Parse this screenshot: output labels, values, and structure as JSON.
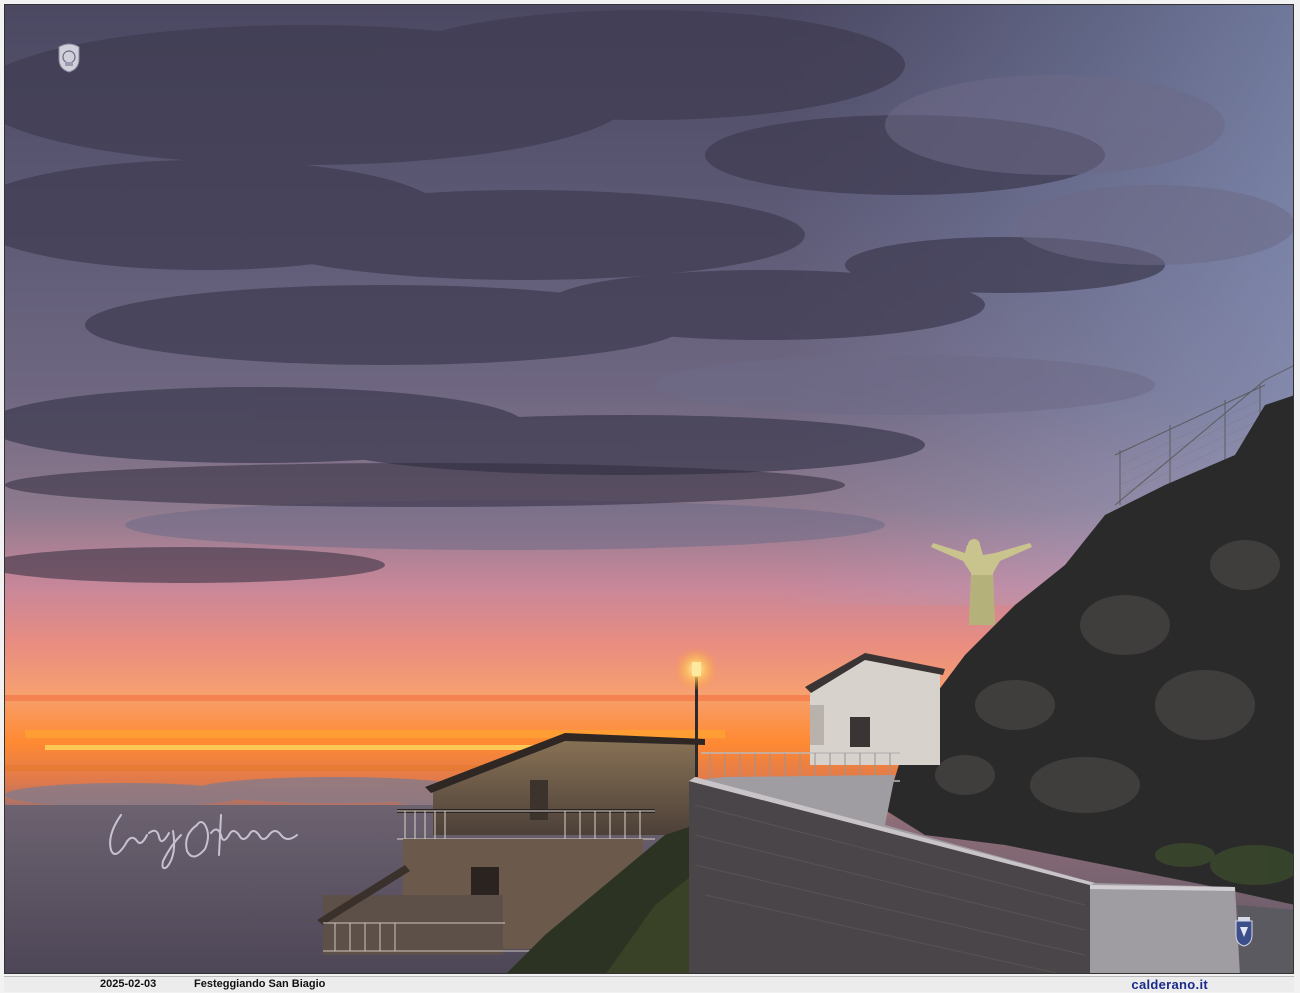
{
  "footer": {
    "date": "2025-02-03",
    "caption": "Festeggiando San Biagio",
    "site": "calderano.it"
  },
  "photo": {
    "subject": "sunset over the sea with statue of Christ on cliff",
    "colors": {
      "sky_top": "#5a5670",
      "sky_mid": "#9a8aa6",
      "glow": "#ff7a2a",
      "sea": "#5c5565",
      "rock": "#2b2a2a"
    }
  },
  "overlays": {
    "logo_icon": "crest-logo-icon",
    "signature_icon": "handwritten-signature",
    "crest_icon": "town-crest-icon"
  }
}
